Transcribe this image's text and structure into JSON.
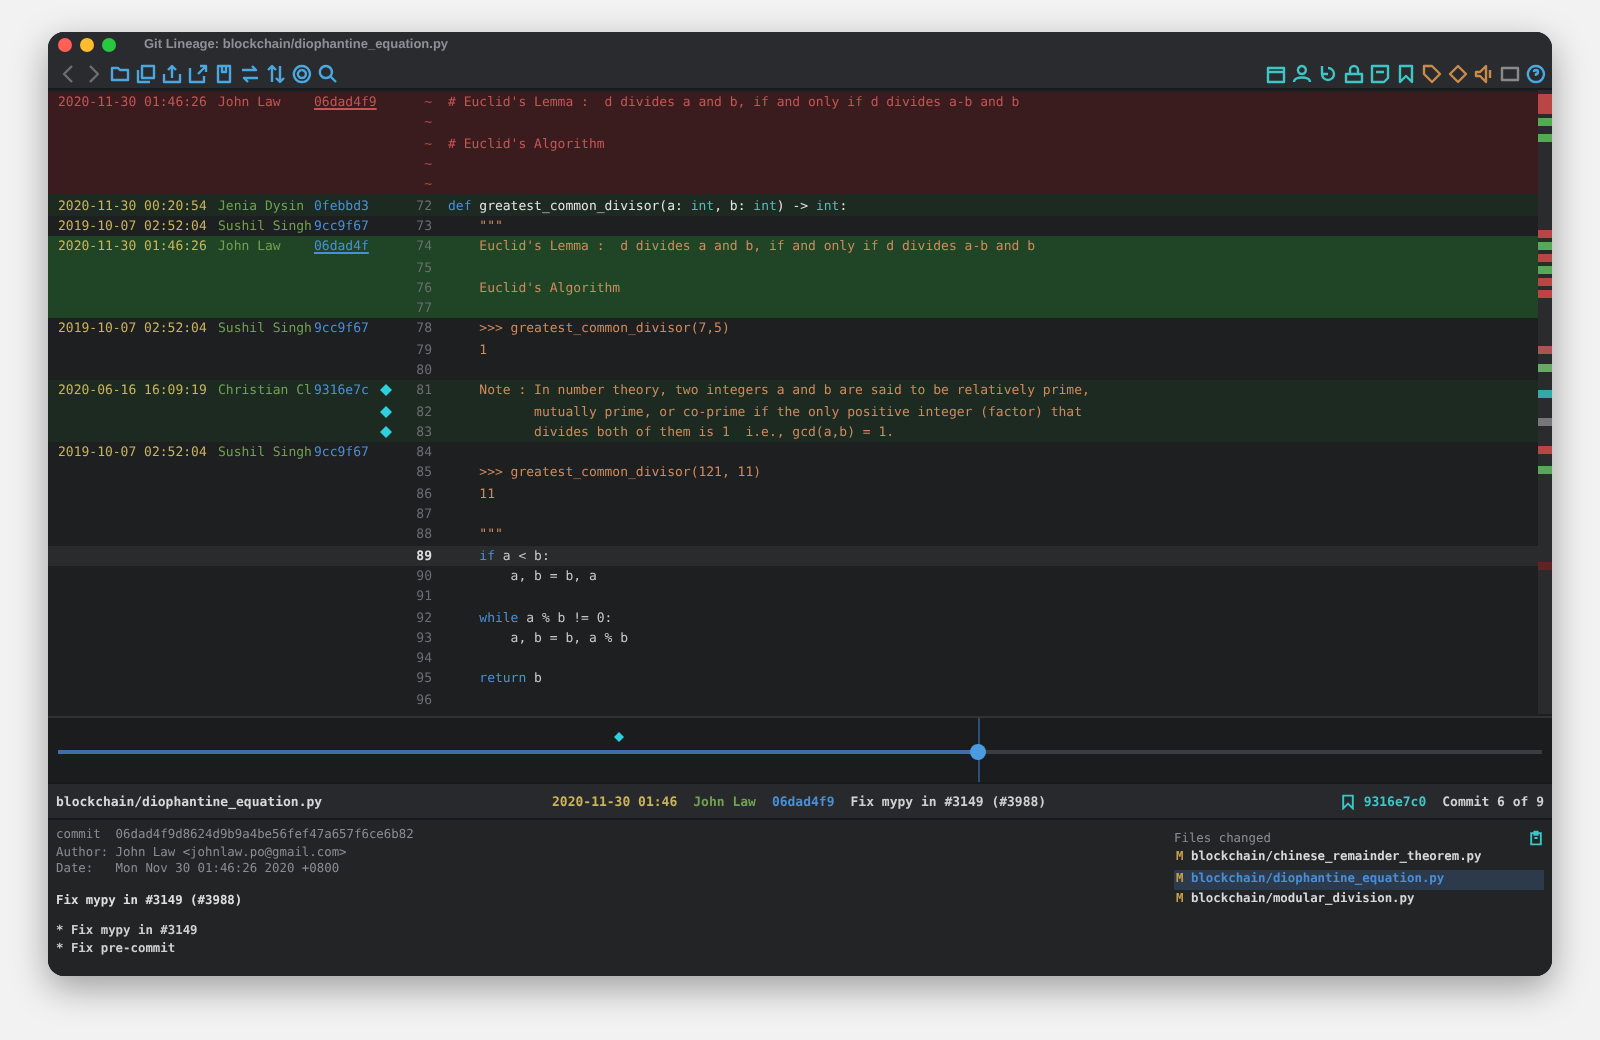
{
  "window": {
    "title": "Git Lineage: blockchain/diophantine_equation.py"
  },
  "rows": [
    {
      "kind": "deleted",
      "marker": false,
      "gutter": "~",
      "blame": {
        "date": "2020-11-30 01:46:26",
        "author": "John Law",
        "hash": "06dad4f9",
        "underlined": true
      },
      "code": [
        {
          "kind": "comment",
          "t": "# Euclid's Lemma :  d divides a and b, if and only if d divides a-b and b"
        }
      ]
    },
    {
      "kind": "deleted",
      "marker": false,
      "gutter": "~"
    },
    {
      "kind": "deleted",
      "marker": false,
      "gutter": "~",
      "code": [
        {
          "kind": "comment",
          "t": "# Euclid's Algorithm"
        }
      ]
    },
    {
      "kind": "deleted",
      "marker": false,
      "gutter": "~"
    },
    {
      "kind": "deleted",
      "marker": false,
      "gutter": "~"
    },
    {
      "kind": "changed",
      "marker": false,
      "gutter": "72",
      "blame": {
        "date": "2020-11-30 00:20:54",
        "author": "Jenia Dysin",
        "hash": "0febbd3",
        "underlined": false
      },
      "code": [
        {
          "kind": "keyword",
          "t": "def "
        },
        {
          "kind": "name",
          "t": "greatest_common_divisor(a: "
        },
        {
          "kind": "type",
          "t": "int"
        },
        {
          "kind": "name",
          "t": ", b: "
        },
        {
          "kind": "type",
          "t": "int"
        },
        {
          "kind": "name",
          "t": ") -> "
        },
        {
          "kind": "type",
          "t": "int"
        },
        {
          "kind": "name",
          "t": ":"
        }
      ]
    },
    {
      "kind": "plain",
      "marker": false,
      "gutter": "73",
      "blame": {
        "date": "2019-10-07 02:52:04",
        "author": "Sushil Singh",
        "hash": "9cc9f67",
        "underlined": false
      },
      "code": [
        {
          "kind": "doc",
          "t": "    \"\"\""
        }
      ]
    },
    {
      "kind": "added",
      "marker": false,
      "gutter": "74",
      "blame": {
        "date": "2020-11-30 01:46:26",
        "author": "John Law",
        "hash": "06dad4f",
        "underlined": true
      },
      "code": [
        {
          "kind": "doc",
          "t": "    Euclid's Lemma :  d divides a and b, if and only if d divides a-b and b"
        }
      ]
    },
    {
      "kind": "added",
      "marker": false,
      "gutter": "75"
    },
    {
      "kind": "added",
      "marker": false,
      "gutter": "76",
      "code": [
        {
          "kind": "doc",
          "t": "    Euclid's Algorithm"
        }
      ]
    },
    {
      "kind": "added",
      "marker": false,
      "gutter": "77"
    },
    {
      "kind": "plain",
      "marker": false,
      "gutter": "78",
      "blame": {
        "date": "2019-10-07 02:52:04",
        "author": "Sushil Singh",
        "hash": "9cc9f67",
        "underlined": false
      },
      "code": [
        {
          "kind": "doc",
          "t": "    >>> greatest_common_divisor(7,5)"
        }
      ]
    },
    {
      "kind": "plain",
      "marker": false,
      "gutter": "79",
      "code": [
        {
          "kind": "doc",
          "t": "    1"
        }
      ]
    },
    {
      "kind": "plain",
      "marker": false,
      "gutter": "80"
    },
    {
      "kind": "changed",
      "marker": true,
      "gutter": "81",
      "blame": {
        "date": "2020-06-16 16:09:19",
        "author": "Christian Cl",
        "hash": "9316e7c",
        "underlined": false
      },
      "code": [
        {
          "kind": "doc",
          "t": "    Note : In number theory, two integers a and b are said to be relatively prime,"
        }
      ]
    },
    {
      "kind": "changed",
      "marker": true,
      "gutter": "82",
      "code": [
        {
          "kind": "doc",
          "t": "           mutually prime, or co-prime if the only positive integer (factor) that"
        }
      ]
    },
    {
      "kind": "changed",
      "marker": true,
      "gutter": "83",
      "code": [
        {
          "kind": "doc",
          "t": "           divides both of them is 1  i.e., gcd(a,b) = 1."
        }
      ]
    },
    {
      "kind": "plain",
      "marker": false,
      "gutter": "84",
      "blame": {
        "date": "2019-10-07 02:52:04",
        "author": "Sushil Singh",
        "hash": "9cc9f67",
        "underlined": false
      }
    },
    {
      "kind": "plain",
      "marker": false,
      "gutter": "85",
      "code": [
        {
          "kind": "doc",
          "t": "    >>> greatest_common_divisor(121, 11)"
        }
      ]
    },
    {
      "kind": "plain",
      "marker": false,
      "gutter": "86",
      "code": [
        {
          "kind": "doc",
          "t": "    11"
        }
      ]
    },
    {
      "kind": "plain",
      "marker": false,
      "gutter": "87"
    },
    {
      "kind": "plain",
      "marker": false,
      "gutter": "88",
      "code": [
        {
          "kind": "doc",
          "t": "    \"\"\""
        }
      ]
    },
    {
      "kind": "current",
      "marker": false,
      "gutter": "89",
      "code": [
        {
          "kind": "keyword",
          "t": "    if"
        },
        {
          "kind": "plain",
          "t": " a < b:"
        }
      ]
    },
    {
      "kind": "plain",
      "marker": false,
      "gutter": "90",
      "code": [
        {
          "kind": "plain",
          "t": "        a, b = b, a"
        }
      ]
    },
    {
      "kind": "plain",
      "marker": false,
      "gutter": "91"
    },
    {
      "kind": "plain",
      "marker": false,
      "gutter": "92",
      "code": [
        {
          "kind": "keyword",
          "t": "    while"
        },
        {
          "kind": "plain",
          "t": " a % b != 0:"
        }
      ]
    },
    {
      "kind": "plain",
      "marker": false,
      "gutter": "93",
      "code": [
        {
          "kind": "plain",
          "t": "        a, b = b, a % b"
        }
      ]
    },
    {
      "kind": "plain",
      "marker": false,
      "gutter": "94"
    },
    {
      "kind": "plain",
      "marker": false,
      "gutter": "95",
      "code": [
        {
          "kind": "keyword",
          "t": "    return"
        },
        {
          "kind": "plain",
          "t": " b"
        }
      ]
    },
    {
      "kind": "plain",
      "marker": false,
      "gutter": "96"
    }
  ],
  "timeline": {
    "level": 0.62
  },
  "status_bar": {
    "path": "blockchain/diophantine_equation.py",
    "date": "2020-11-30 01:46",
    "author": "John Law",
    "hash": "06dad4f9",
    "message": "Fix mypy in #3149 (#3988)",
    "bookmark": "9316e7c0",
    "position": "Commit 6 of 9"
  },
  "commit": {
    "header": [
      "commit  06dad4f9d8624d9b9a4be56fef47a657f6ce6b82",
      "Author: John Law <johnlaw.po@gmail.com>",
      "Date:   Mon Nov 30 01:46:26 2020 +0800"
    ],
    "subject": "Fix mypy in #3149 (#3988)",
    "body": [
      "* Fix mypy in #3149",
      "* Fix pre-commit"
    ]
  },
  "files_changed": {
    "title": "Files changed",
    "files": [
      {
        "status": "M",
        "path": "blockchain/chinese_remainder_theorem.py",
        "selected": false
      },
      {
        "status": "M",
        "path": "blockchain/diophantine_equation.py",
        "selected": true
      },
      {
        "status": "M",
        "path": "blockchain/modular_division.py",
        "selected": false
      }
    ]
  }
}
